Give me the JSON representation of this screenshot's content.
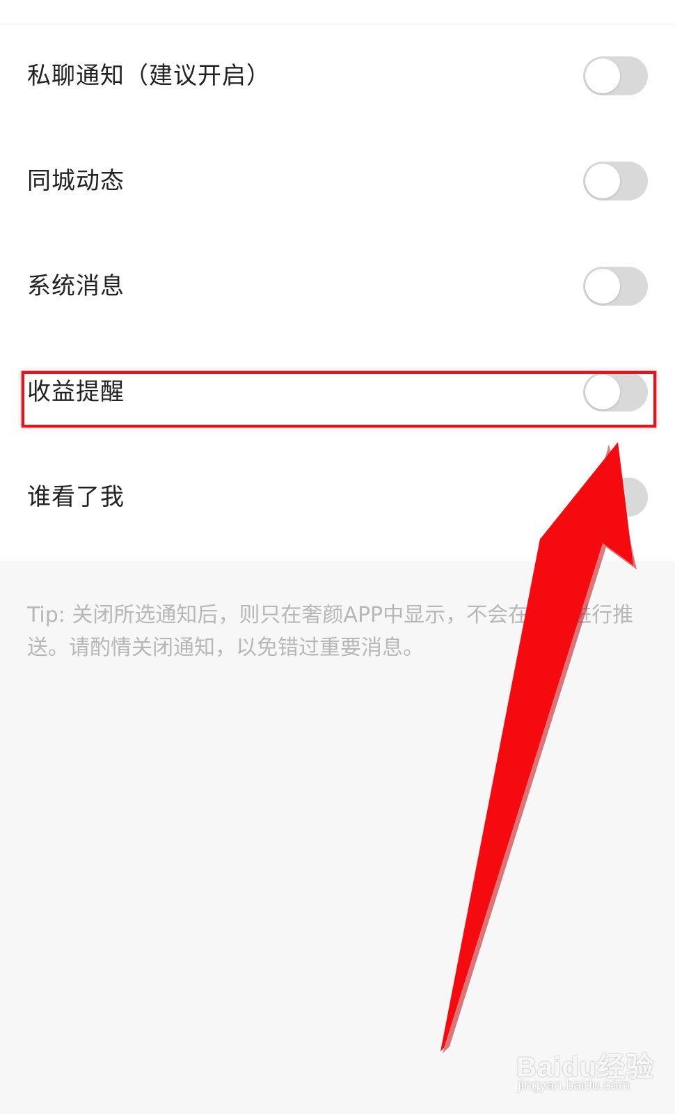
{
  "settings": {
    "items": [
      {
        "label": "私聊通知（建议开启）",
        "enabled": false
      },
      {
        "label": "同城动态",
        "enabled": false
      },
      {
        "label": "系统消息",
        "enabled": false
      },
      {
        "label": "收益提醒",
        "enabled": false
      },
      {
        "label": "谁看了我",
        "enabled": false
      }
    ]
  },
  "tip": {
    "text": "Tip: 关闭所选通知后，则只在奢颜APP中显示，不会在外部进行推送。请酌情关闭通知，以免错过重要消息。"
  },
  "annotation": {
    "highlighted_item": "收益提醒",
    "color": "#e8141b"
  },
  "watermark": {
    "brand": "Baidu经验",
    "url": "jingyan.baidu.com"
  },
  "colors": {
    "toggle_off": "#d9d9d9",
    "background": "#f7f7f7",
    "panel": "#ffffff",
    "tip_text": "#b7b7b7"
  }
}
